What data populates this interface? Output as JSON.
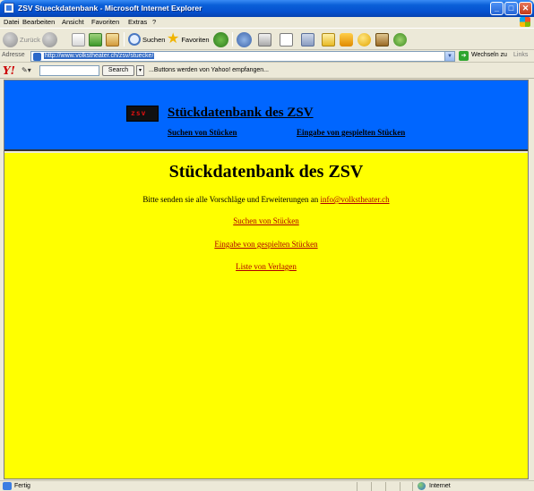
{
  "window": {
    "title": "ZSV Stueckdatenbank - Microsoft Internet Explorer",
    "minimize": "_",
    "maximize": "□",
    "close": "✕"
  },
  "menu": [
    "Datei",
    "Bearbeiten",
    "Ansicht",
    "Favoriten",
    "Extras",
    "?"
  ],
  "toolbar": {
    "back_label": "Zurück",
    "search_label": "Suchen",
    "favorites_label": "Favoriten"
  },
  "address": {
    "label": "Adresse",
    "url": "http://www.volkstheater.ch/zsv/stuecke/",
    "go_label": "Wechseln zu",
    "links_label": "Links"
  },
  "yahoo": {
    "logo": "Y!",
    "search_label": "Search",
    "info": "...Buttons werden von Yahoo! empfangen..."
  },
  "header": {
    "logo_text": "zsv",
    "title": "Stückdatenbank des ZSV",
    "link_search": "Suchen von Stücken",
    "link_entry": "Eingabe von gespielten Stücken"
  },
  "content": {
    "title": "Stückdatenbank des ZSV",
    "intro_text": "Bitte senden sie alle Vorschläge und Erweiterungen an ",
    "email": "info@volkstheater.ch",
    "link_search": "Suchen von Stücken",
    "link_entry": "Eingabe von gespielten Stücken",
    "link_publishers": "Liste von Verlagen"
  },
  "status": {
    "text": "Fertig",
    "zone": "Internet"
  },
  "colors": {
    "header_bg": "#0066ff",
    "content_bg": "#ffff00",
    "link": "#b00000"
  }
}
